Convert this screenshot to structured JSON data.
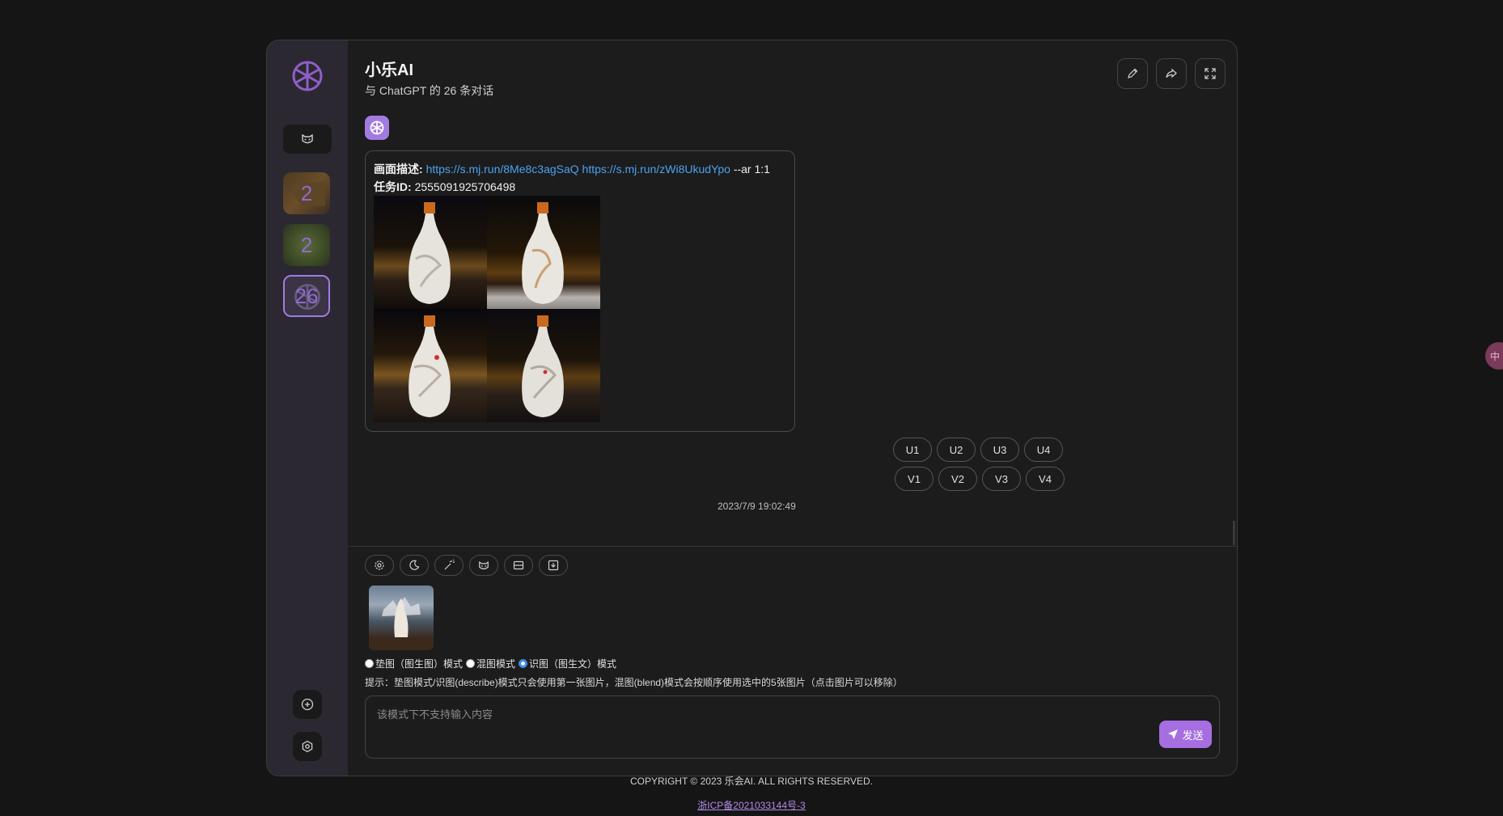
{
  "header": {
    "title": "小乐AI",
    "subtitle": "与 ChatGPT 的 26 条对话"
  },
  "sidebar": {
    "chats": [
      {
        "count": "2"
      },
      {
        "count": "2"
      },
      {
        "count": "26",
        "selected": true
      }
    ]
  },
  "message": {
    "desc_label": "画面描述:",
    "link1": "https://s.mj.run/8Me8c3agSaQ",
    "link2": "https://s.mj.run/zWi8UkudYpo",
    "param": "--ar 1:1",
    "task_label": "任务ID:",
    "task_id": "2555091925706498",
    "upscale_buttons": [
      "U1",
      "U2",
      "U3",
      "U4"
    ],
    "variation_buttons": [
      "V1",
      "V2",
      "V3",
      "V4"
    ],
    "timestamp": "2023/7/9 19:02:49"
  },
  "composer": {
    "modes": [
      {
        "label": "垫图（图生图）模式",
        "selected": false
      },
      {
        "label": "混图模式",
        "selected": false
      },
      {
        "label": "识图（图生文）模式",
        "selected": true
      }
    ],
    "hint": "提示：垫图模式/识图(describe)模式只会使用第一张图片，混图(blend)模式会按顺序使用选中的5张图片（点击图片可以移除）",
    "placeholder": "该模式下不支持输入内容",
    "send_label": "发送"
  },
  "footer": {
    "copyright": "COPYRIGHT © 2023 乐会AI. ALL RIGHTS RESERVED.",
    "icp": "浙ICP备2021033144号-3"
  },
  "edge_badge": "中",
  "colors": {
    "accent": "#a66ee0",
    "link": "#4aa3f0",
    "sidebar_bg": "#2c2832",
    "page_bg": "#151515"
  }
}
